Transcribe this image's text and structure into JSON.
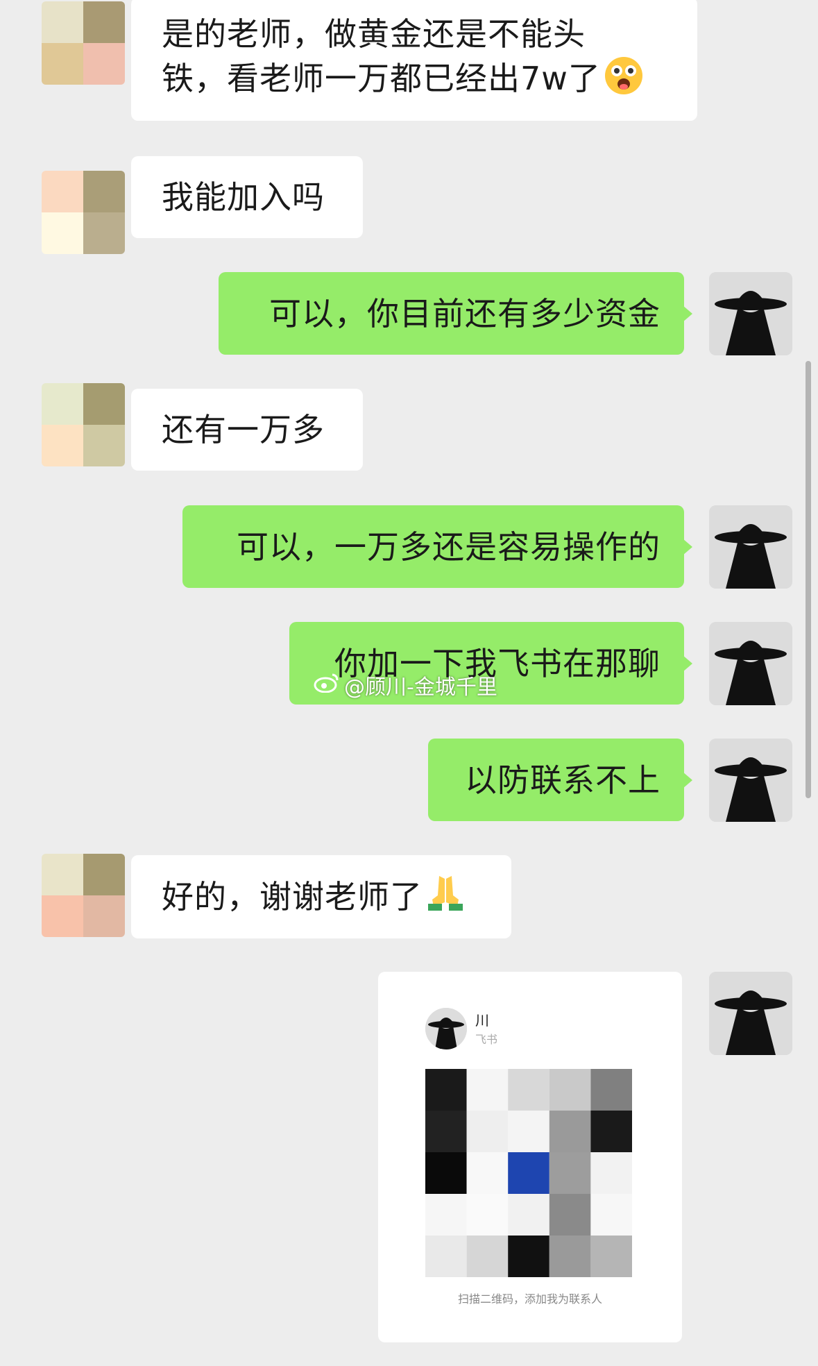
{
  "messages": [
    {
      "side": "in",
      "lines": [
        "是的老师，做黄金还是不能头",
        "铁，看老师一万都已经出7w了"
      ],
      "emoji": "face-emoji",
      "avatar_colors": [
        "#e7e2c8",
        "#a99a73",
        "#e0c896",
        "#f0bfae"
      ]
    },
    {
      "side": "in",
      "text": "我能加入吗",
      "avatar_colors": [
        "#fbd9c0",
        "#aa9e78",
        "#fff9e2",
        "#baae8e"
      ]
    },
    {
      "side": "out",
      "text": "可以，你目前还有多少资金"
    },
    {
      "side": "in",
      "text": "还有一万多",
      "avatar_colors": [
        "#e6e9cc",
        "#a59c70",
        "#fde2c2",
        "#cfc9a3"
      ]
    },
    {
      "side": "out",
      "text": "可以，一万多还是容易操作的"
    },
    {
      "side": "out",
      "text": "你加一下我飞书在那聊"
    },
    {
      "side": "out",
      "text": "以防联系不上"
    },
    {
      "side": "in",
      "text": "好的，谢谢老师了",
      "emoji": "pray-emoji",
      "avatar_colors": [
        "#e9e4c9",
        "#a69a70",
        "#f8c2aa",
        "#e2b8a3"
      ]
    }
  ],
  "watermark": {
    "text": "@顾川-金城千里",
    "icon": "weibo-icon"
  },
  "card": {
    "name": "川",
    "subtitle": "飞书",
    "caption": "扫描二维码，添加我为联系人",
    "qr_cells": [
      "#1a1a1a",
      "#f5f5f5",
      "#d8d8d8",
      "#c9c9c9",
      "#808080",
      "#222222",
      "#eeeeee",
      "#f4f4f4",
      "#9a9a9a",
      "#1a1a1a",
      "#0a0a0a",
      "#f8f8f8",
      "#1e45b0",
      "#9d9d9d",
      "#f2f2f2",
      "#f6f6f6",
      "#fafafa",
      "#f1f1f1",
      "#8a8a8a",
      "#f7f7f7",
      "#e9e9e9",
      "#d6d6d6",
      "#111111",
      "#9a9a9a",
      "#b5b5b5"
    ]
  },
  "colors": {
    "bg": "#ededed",
    "incoming": "#ffffff",
    "outgoing": "#95ec69"
  }
}
